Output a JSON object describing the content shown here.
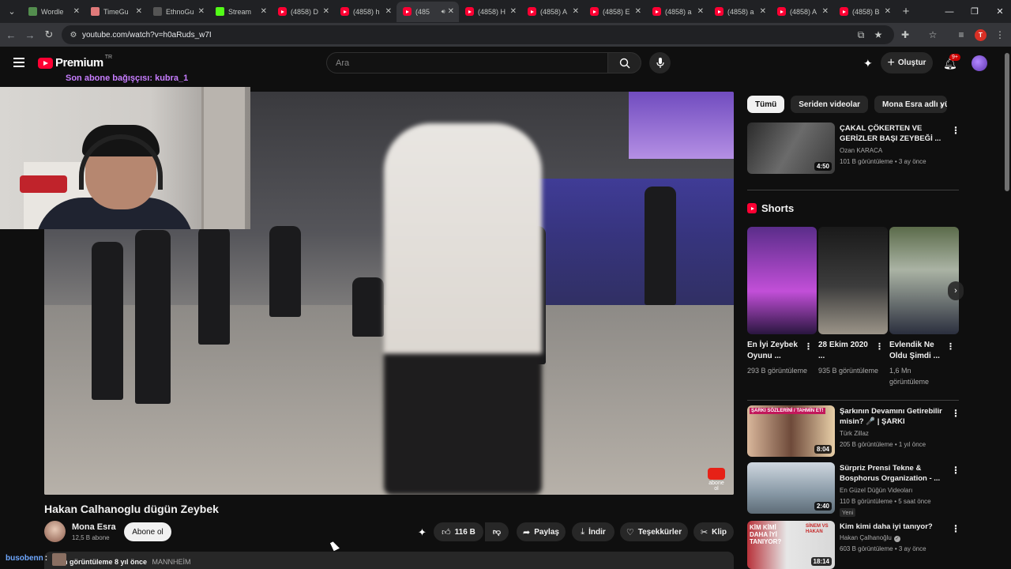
{
  "browser": {
    "tabs": [
      {
        "title": "Wordle",
        "icon": "wordle-icon",
        "icon_color": "#538d4e",
        "active": false
      },
      {
        "title": "TimeGu",
        "icon": "timeguessr-icon",
        "icon_color": "#e07a7a",
        "active": false
      },
      {
        "title": "EthnoGu",
        "icon": "ethnoguessr-icon",
        "icon_color": "#555555",
        "active": false
      },
      {
        "title": "Stream",
        "icon": "kick-icon",
        "icon_color": "#53fc18",
        "active": false
      },
      {
        "title": "(4858) D",
        "icon": "youtube-icon",
        "active": false
      },
      {
        "title": "(4858) h",
        "icon": "youtube-icon",
        "active": false
      },
      {
        "title": "(485",
        "icon": "youtube-icon",
        "active": true
      },
      {
        "title": "(4858) H",
        "icon": "youtube-icon",
        "active": false
      },
      {
        "title": "(4858) A",
        "icon": "youtube-icon",
        "active": false
      },
      {
        "title": "(4858) E",
        "icon": "youtube-icon",
        "active": false
      },
      {
        "title": "(4858) a",
        "icon": "youtube-icon",
        "active": false
      },
      {
        "title": "(4858) a",
        "icon": "youtube-icon",
        "active": false
      },
      {
        "title": "(4858) A",
        "icon": "youtube-icon",
        "active": false
      },
      {
        "title": "(4858) B",
        "icon": "youtube-icon",
        "active": false
      }
    ],
    "url": "youtube.com/watch?v=h0aRuds_w7I",
    "profile_initial": "T"
  },
  "masthead": {
    "logo_text": "Premium",
    "country": "TR",
    "search_placeholder": "Ara",
    "create_label": "Oluştur",
    "notif_count": "9+"
  },
  "overlay": {
    "donor_text": "Son abone bağışçısı: kubra_1"
  },
  "video": {
    "title": "Hakan Calhanoglu dügün Zeybek",
    "channel": "Mona Esra",
    "subs": "12,5 B abone",
    "subscribe_label": "Abone ol",
    "likes": "116 B",
    "share_label": "Paylaş",
    "download_label": "İndir",
    "thanks_label": "Teşekkürler",
    "clip_label": "Klip",
    "watermark": "abone ol",
    "desc_line": "n görüntüleme  8 yıl önce",
    "desc_tag": "MANNHEİM"
  },
  "chat": {
    "username": "busobenn",
    "colon": ":"
  },
  "sidebar": {
    "chips": [
      "Tümü",
      "Seriden videolar",
      "Mona Esra adlı yükle"
    ],
    "recs_top": [
      {
        "title": "ÇAKAL ÇÖKERTEN VE GERİZLER BAŞI ZEYBEĞİ ...",
        "channel": "Ozan KARACA",
        "meta": "101 B görüntüleme • 3 ay önce",
        "duration": "4:50"
      }
    ],
    "shorts_label": "Shorts",
    "shorts": [
      {
        "title": "En İyi Zeybek Oyunu ...",
        "views": "293 B görüntüleme"
      },
      {
        "title": "28 Ekim 2020 ...",
        "views": "935 B görüntüleme"
      },
      {
        "title": "Evlendik Ne Oldu Şimdi ...",
        "views": "1,6 Mn görüntüleme"
      }
    ],
    "recs": [
      {
        "title": "Şarkının Devamını Getirebilir misin? 🎤 | ŞARKI SÖZLERİNİ ...",
        "channel": "Türk Zillaz",
        "meta": "205 B görüntüleme • 1 yıl önce",
        "duration": "8:04",
        "thumb_text": "ŞARKI SÖZLERİNİ / TAHMİN ET!",
        "badge": ""
      },
      {
        "title": "Sürpriz Prensi Tekne & Bosphorus Organization - ...",
        "channel": "En Güzel Düğün Videoları",
        "meta": "110 B görüntüleme • 5 saat önce",
        "duration": "2:40",
        "thumb_text": "",
        "badge": "Yeni"
      },
      {
        "title": "Kim kimi daha iyi tanıyor?",
        "channel": "Hakan Çalhanoğlu",
        "meta": "603 B görüntüleme • 3 ay önce",
        "duration": "18:14",
        "thumb_text": "KİM KİMİ DAHA İYİ TANIYOR?",
        "thumb_text2": "SİNEM VS HAKAN",
        "badge": ""
      }
    ]
  }
}
